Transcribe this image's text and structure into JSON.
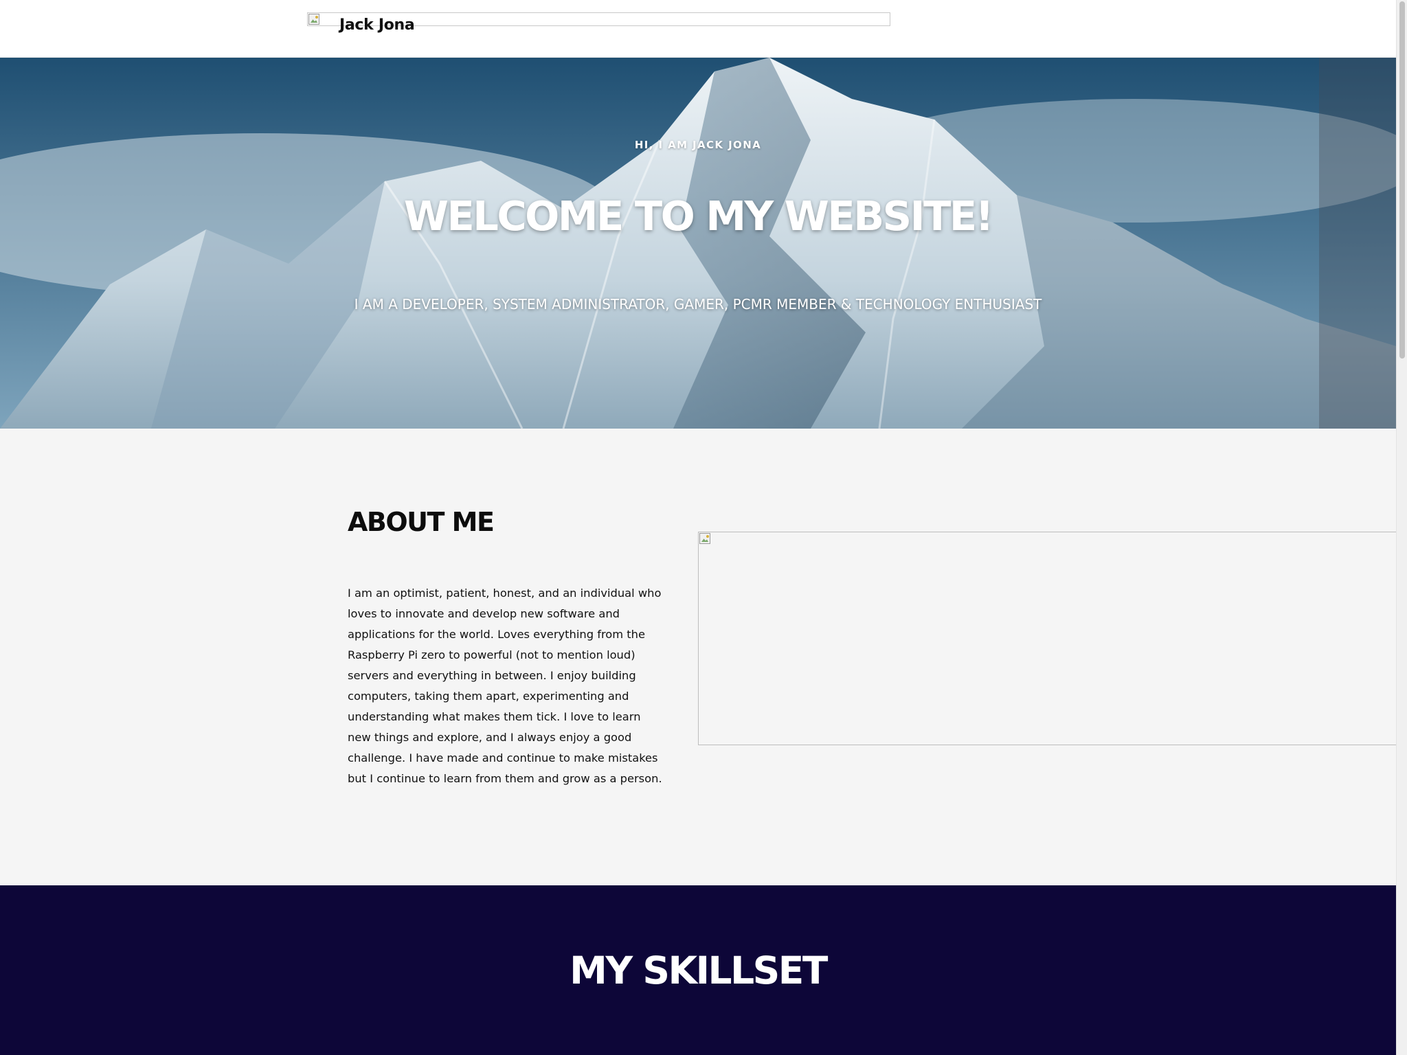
{
  "header": {
    "brand": "Jack Jona",
    "logo_icon": "broken-image-icon"
  },
  "hero": {
    "eyebrow": "HI, I AM JACK JONA",
    "title": "WELCOME TO MY WEBSITE!",
    "subtitle": "I AM A DEVELOPER, SYSTEM ADMINISTRATOR, GAMER, PCMR MEMBER & TECHNOLOGY ENTHUSIAST"
  },
  "about": {
    "title": "ABOUT ME",
    "body": "I am an optimist, patient, honest, and an individual who loves to innovate and develop new software and applications for the world. Loves everything from the Raspberry Pi zero to powerful (not to mention loud) servers and everything in between. I enjoy building computers, taking them apart, experimenting and understanding what makes them tick. I love to learn new things and explore, and I always enjoy a good challenge. I have made and continue to make mistakes but I continue to learn from them and grow as a person.",
    "image_icon": "broken-image-icon"
  },
  "skills": {
    "title": "MY SKILLSET"
  },
  "colors": {
    "skills_background": "#0d0638",
    "about_background": "#f5f5f5",
    "header_background": "#ffffff"
  }
}
